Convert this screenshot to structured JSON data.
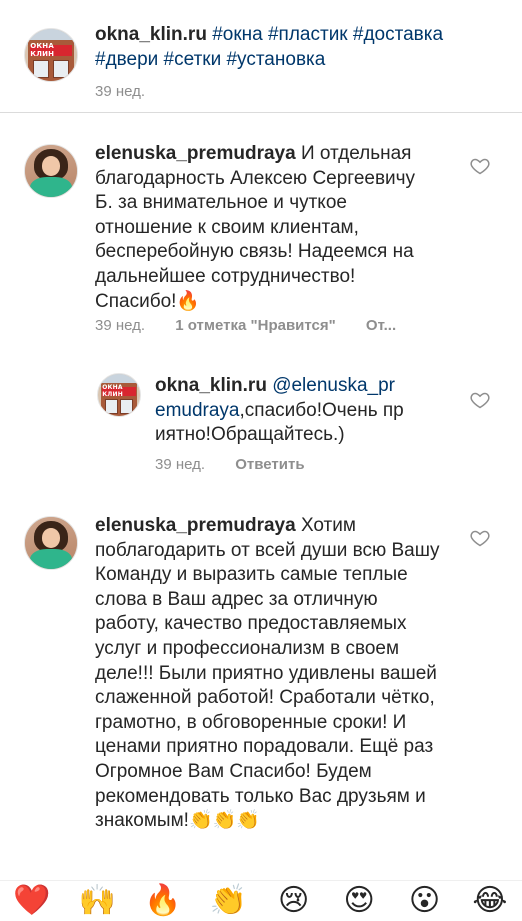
{
  "caption": {
    "username": "okna_klin.ru",
    "tags": "#окна #пластик #доставка #двери #сетки #установка",
    "time": "39 нед.",
    "avatar_sign": "ОКНА КЛИН"
  },
  "comments": [
    {
      "username": "elenuska_premudraya",
      "text": "И отдельная благодарность Алексею Сергеевичу Б. за внимательное и чуткое отношение к своим клиентам, бесперебойную связь! Надеемся на дальнейшее сотрудничество! Спасибо!",
      "emoji": "🔥",
      "time": "39 нед.",
      "likes": "1 отметка \"Нравится\"",
      "reply_label": "От..."
    },
    {
      "username": "elenuska_premudraya",
      "text": "Хотим поблагодарить от всей души всю Вашу  Команду и выразить самые теплые слова в Ваш адрес за отличную работу, качество предоставляемых услуг и профессионализм в своем деле!!! Были приятно удивлены вашей слаженной работой! Сработали чётко, грамотно, в обговоренные сроки! И ценами приятно порадовали. Ещё раз Огромное Вам Спасибо! Будем рекомендовать только Вас друзьям и знакомым!",
      "emoji": "👏👏👏"
    }
  ],
  "reply": {
    "username": "okna_klin.ru",
    "mention": "@elenuska_premudraya",
    "text": ",спасибо!Очень приятно!Обращайтесь.)",
    "time": "39 нед.",
    "reply_label": "Ответить",
    "avatar_sign": "ОКНА КЛИН"
  },
  "emoji_bar": [
    "❤️",
    "🙌",
    "🔥",
    "👏",
    "😢",
    "😍",
    "😮",
    "😂"
  ]
}
